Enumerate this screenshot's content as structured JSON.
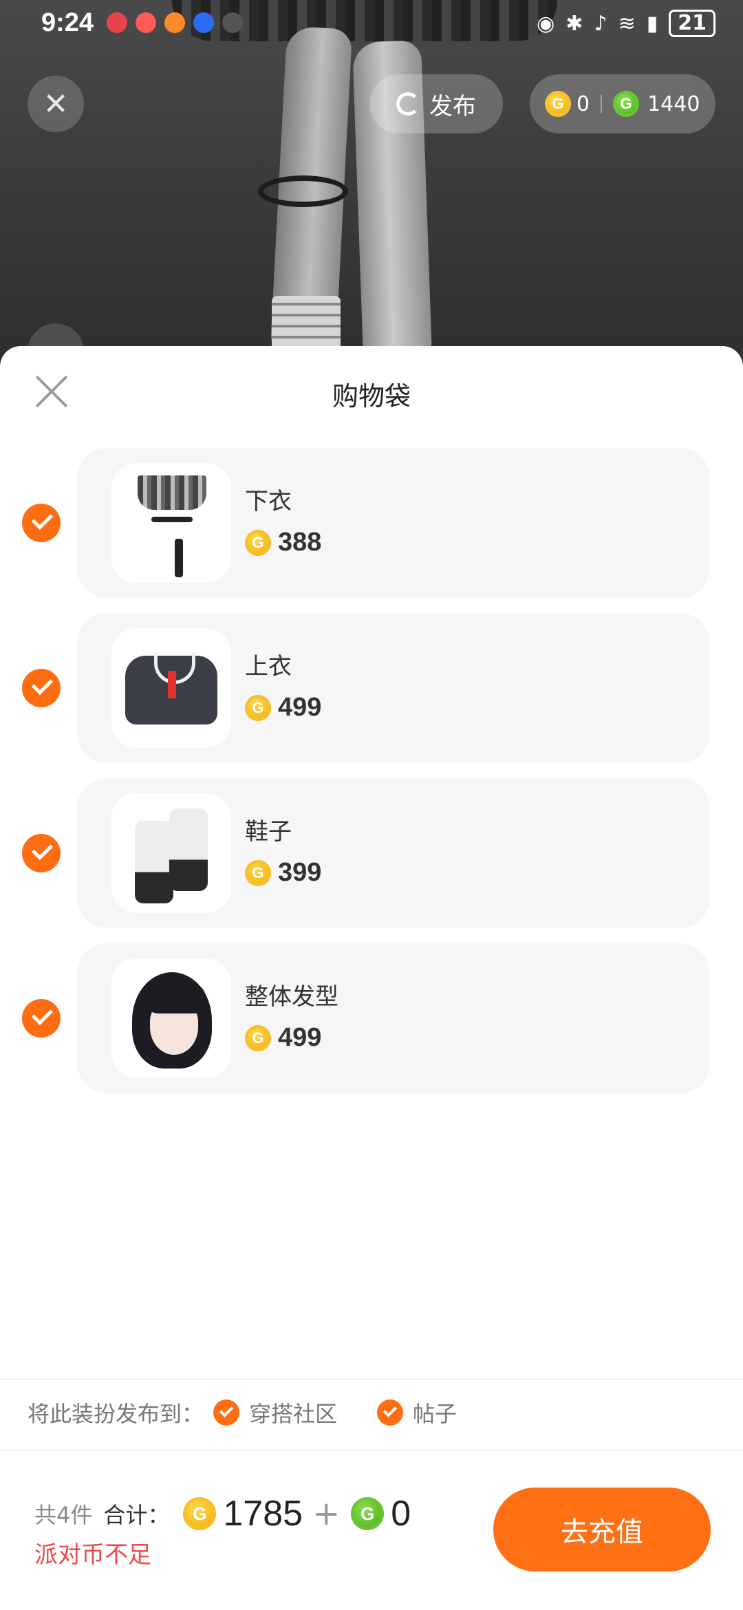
{
  "status_bar": {
    "time": "9:24",
    "battery": "21"
  },
  "scene": {
    "publish_label": "发布",
    "gold_balance": "0",
    "green_balance": "1440"
  },
  "sheet": {
    "title": "购物袋",
    "items": [
      {
        "name": "下衣",
        "price": "388",
        "checked": true,
        "thumb": "skirt"
      },
      {
        "name": "上衣",
        "price": "499",
        "checked": true,
        "thumb": "jacket"
      },
      {
        "name": "鞋子",
        "price": "399",
        "checked": true,
        "thumb": "boots"
      },
      {
        "name": "整体发型",
        "price": "499",
        "checked": true,
        "thumb": "hairstyle"
      }
    ]
  },
  "publish_to": {
    "label": "将此装扮发布到：",
    "options": [
      "穿搭社区",
      "帖子"
    ]
  },
  "footer": {
    "count": "共4件",
    "sum_label": "合计：",
    "gold_total": "1785",
    "plus": "+",
    "green_total": "0",
    "warning": "派对币不足",
    "recharge_label": "去充值"
  },
  "colors": {
    "accent": "#ff7015",
    "warning": "#f04848"
  }
}
